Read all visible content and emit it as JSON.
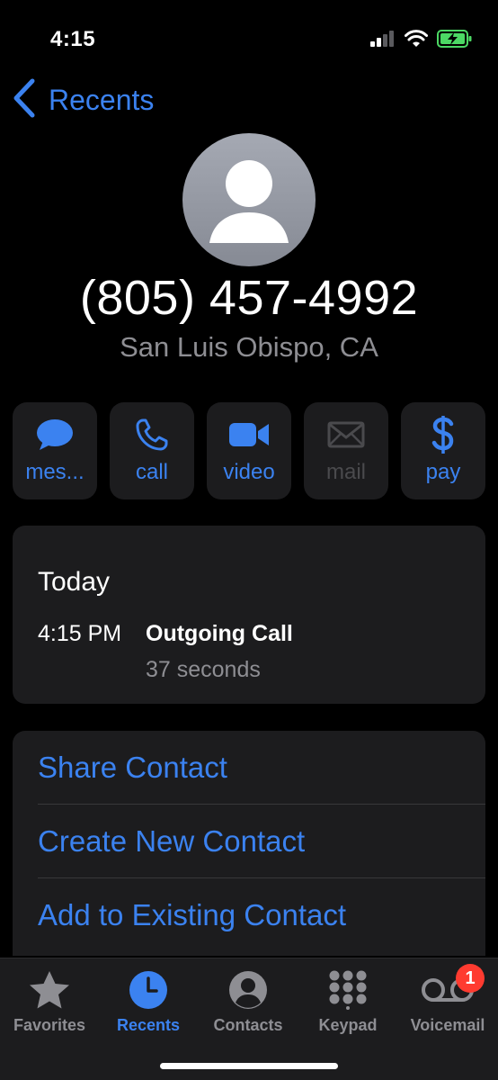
{
  "status_bar": {
    "time": "4:15",
    "battery_color": "#4cd964"
  },
  "nav": {
    "back_label": "Recents"
  },
  "contact": {
    "phone_number": "(805) 457-4992",
    "location": "San Luis Obispo, CA"
  },
  "actions": [
    {
      "label": "mes...",
      "icon": "message-icon",
      "enabled": true
    },
    {
      "label": "call",
      "icon": "phone-icon",
      "enabled": true
    },
    {
      "label": "video",
      "icon": "video-icon",
      "enabled": true
    },
    {
      "label": "mail",
      "icon": "mail-icon",
      "enabled": false
    },
    {
      "label": "pay",
      "icon": "dollar-icon",
      "enabled": true
    }
  ],
  "history": {
    "day": "Today",
    "time": "4:15 PM",
    "type": "Outgoing Call",
    "duration": "37 seconds"
  },
  "options": [
    {
      "label": "Share Contact"
    },
    {
      "label": "Create New Contact"
    },
    {
      "label": "Add to Existing Contact"
    }
  ],
  "tab_bar": {
    "tabs": [
      {
        "label": "Favorites",
        "icon": "star-icon",
        "active": false
      },
      {
        "label": "Recents",
        "icon": "clock-icon",
        "active": true
      },
      {
        "label": "Contacts",
        "icon": "person-circle-icon",
        "active": false
      },
      {
        "label": "Keypad",
        "icon": "keypad-icon",
        "active": false
      },
      {
        "label": "Voicemail",
        "icon": "voicemail-icon",
        "active": false,
        "badge": "1"
      }
    ]
  },
  "colors": {
    "accent": "#3b82f0",
    "background": "#000000",
    "card": "#1c1c1e",
    "secondary_text": "#8e8e93",
    "badge": "#ff3b30"
  }
}
